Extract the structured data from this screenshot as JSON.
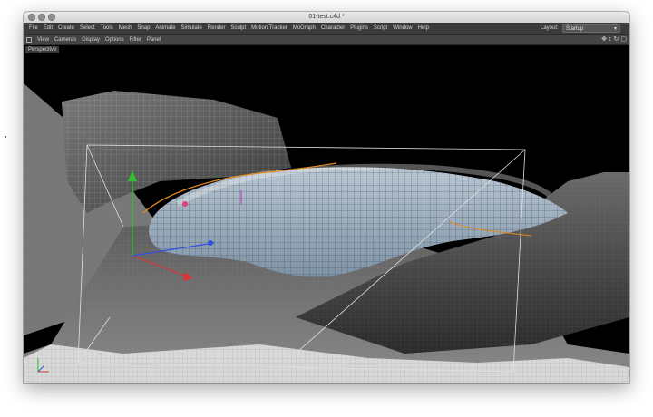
{
  "window": {
    "title": "01-test.c4d *"
  },
  "menubar": {
    "items": [
      "File",
      "Edit",
      "Create",
      "Select",
      "Tools",
      "Mesh",
      "Snap",
      "Animate",
      "Simulate",
      "Render",
      "Sculpt",
      "Motion Tracker",
      "MoGraph",
      "Character",
      "Plugins",
      "Script",
      "Window",
      "Help"
    ],
    "layout_label": "Layout:",
    "layout_value": "Startup"
  },
  "viewbar": {
    "items": [
      "View",
      "Cameras",
      "Display",
      "Options",
      "Filter",
      "Panel"
    ]
  },
  "viewport": {
    "label": "Perspective"
  },
  "colors": {
    "menubar_bg": "#3b3b3b",
    "viewport_bg": "#000000",
    "axis_x": "#e03030",
    "axis_y": "#30c030",
    "axis_z": "#3050e0",
    "spline": "#e08a20"
  },
  "icons": [
    "close-icon",
    "minimize-icon",
    "zoom-icon",
    "panel-menu-icon",
    "move-view-icon",
    "zoom-view-icon",
    "rotate-view-icon",
    "toggle-view-icon"
  ]
}
